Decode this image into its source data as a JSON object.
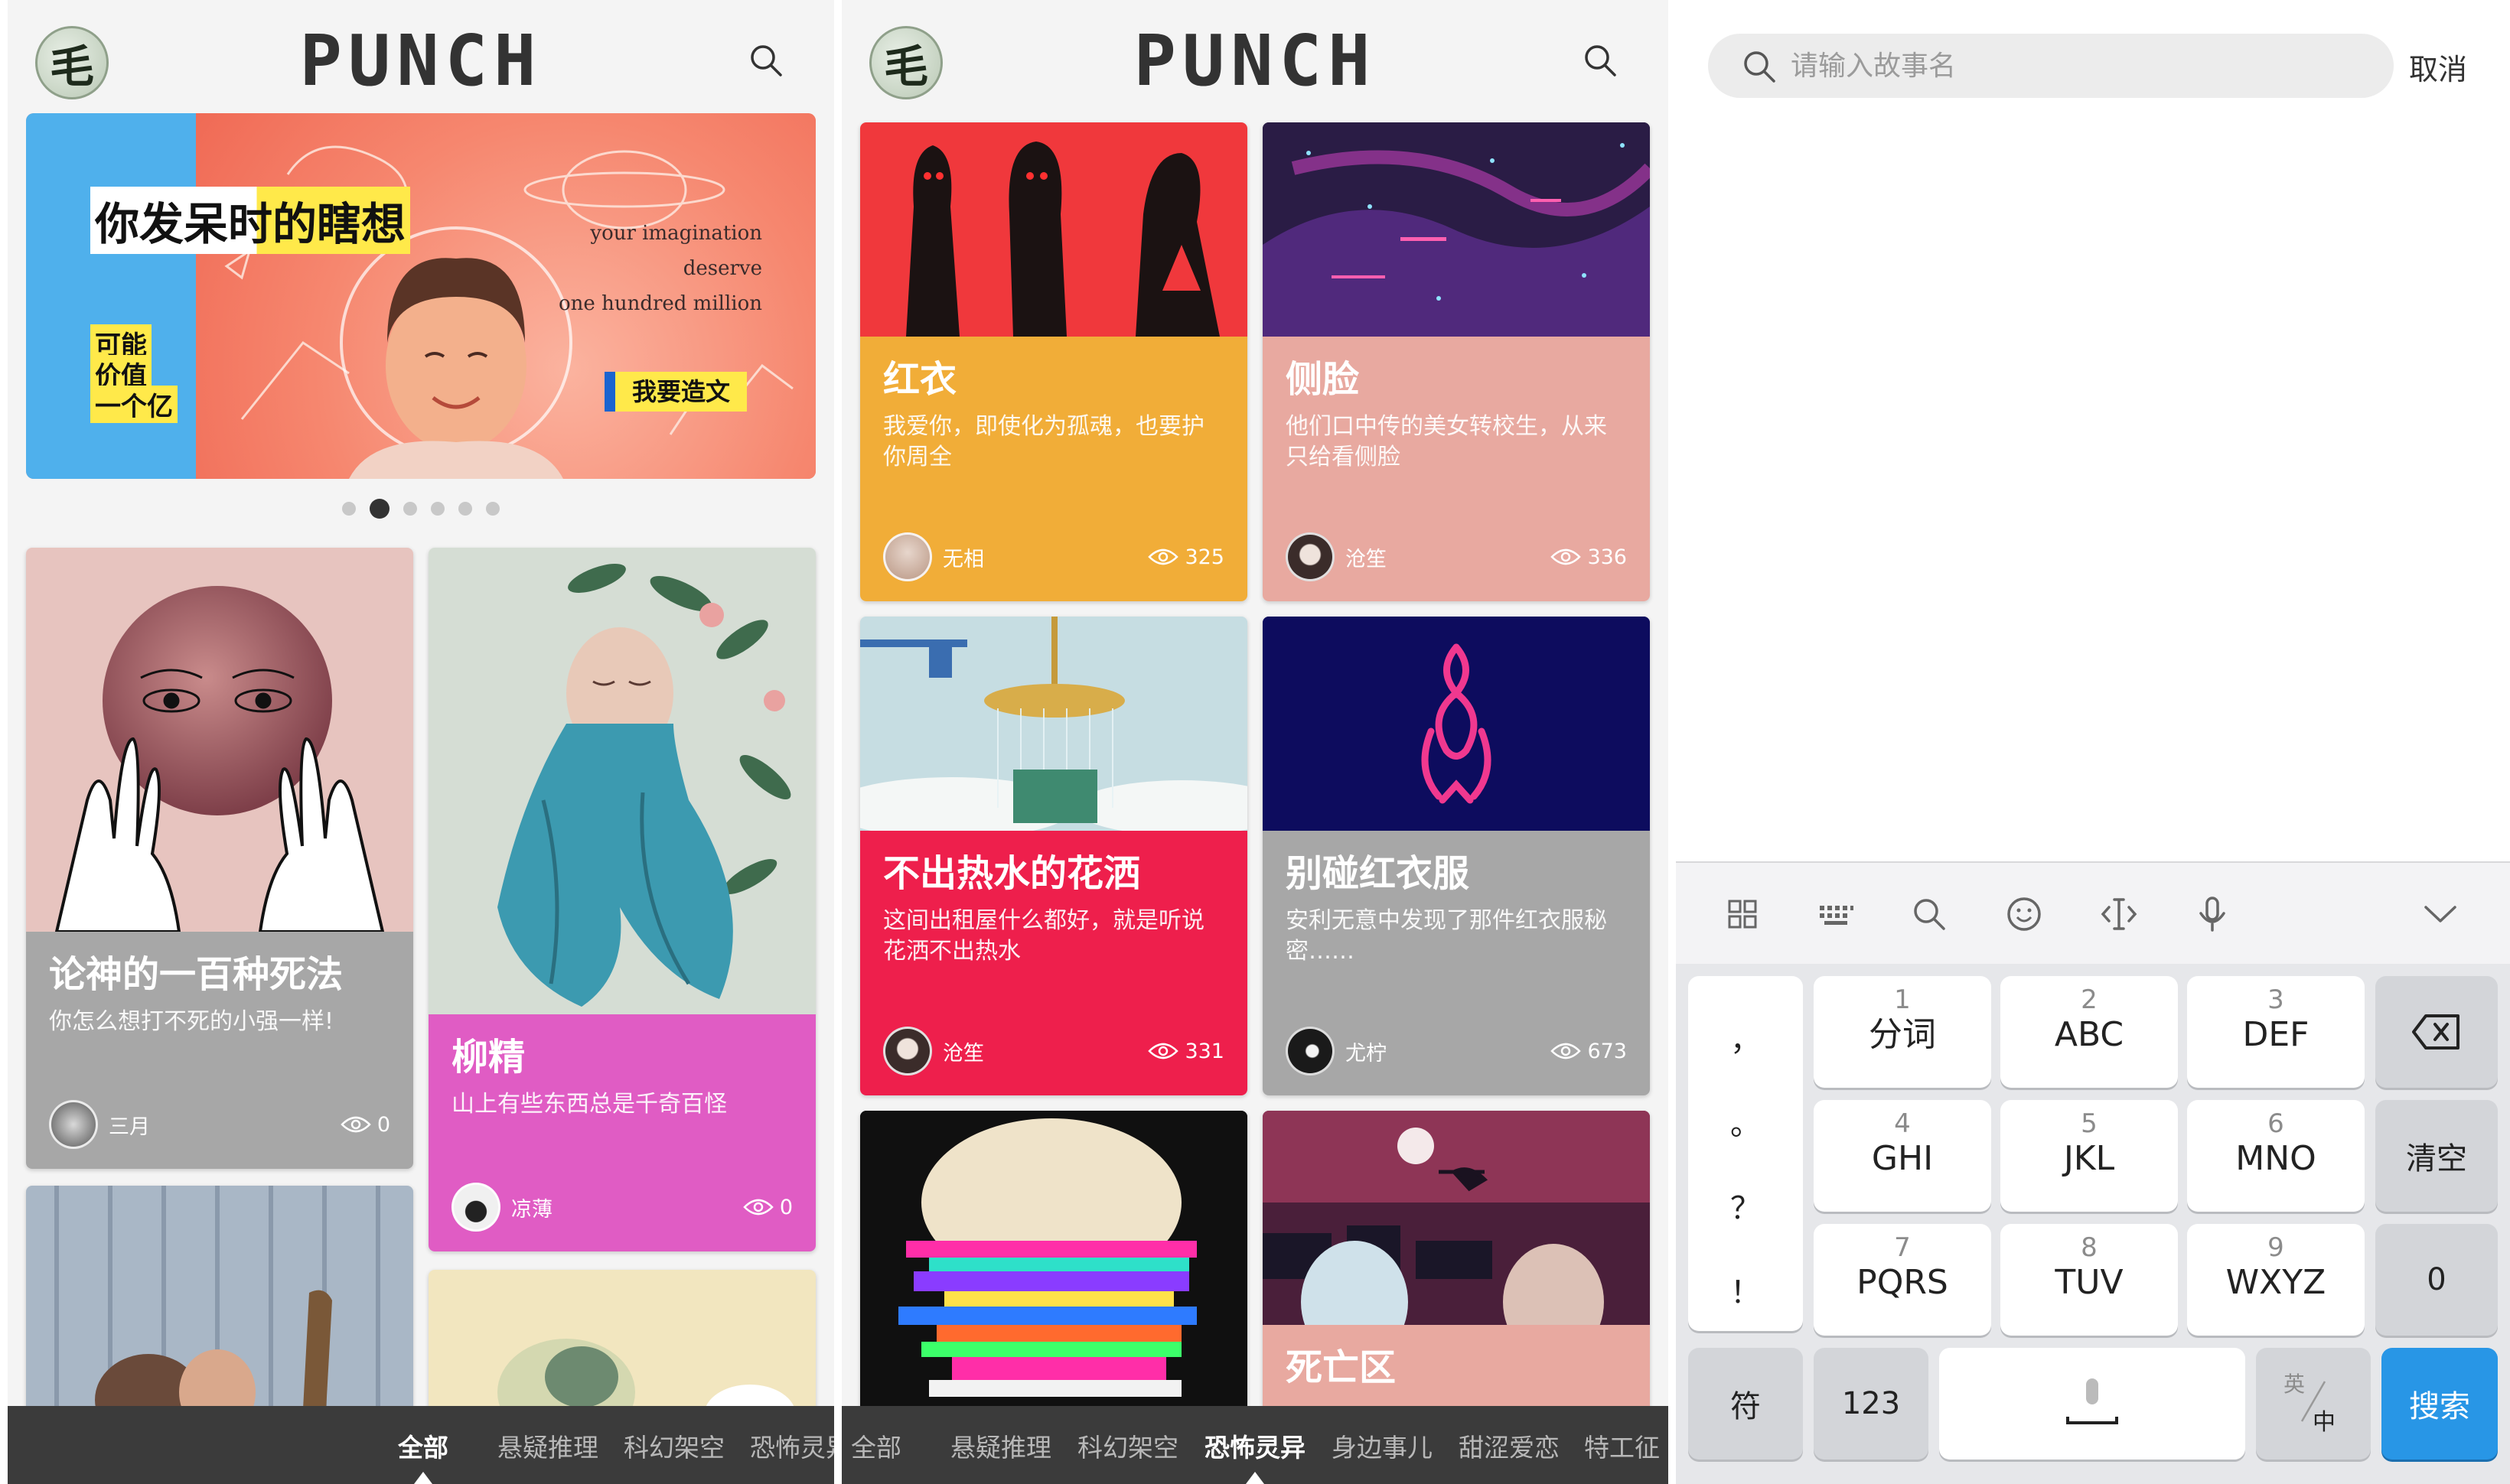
{
  "colors": {
    "accent_blue": "#2896e6",
    "category_bar": "#3b3b3b",
    "banner_blue": "#4fb0ec",
    "banner_coral": "#f5876f",
    "banner_yellow": "#ffe94a"
  },
  "app": {
    "logo_char": "毛",
    "brand": "PUNCH"
  },
  "banner": {
    "headline": "你发呆时的瞎想",
    "side_line1": "可能",
    "side_line2": "价值",
    "side_line3": "一个亿",
    "english_line1": "your imagination",
    "english_line2": "deserve",
    "english_line3": "one hundred million",
    "cta": "我要造文",
    "pager_count": 6,
    "pager_active": 2
  },
  "screen1": {
    "cards": [
      {
        "title": "论神的一百种死法",
        "desc": "你怎么想打不死的小强一样!",
        "author": "三月",
        "views": "0",
        "color": "#a7a7a7"
      },
      {
        "title": "柳精",
        "desc": "山上有些东西总是千奇百怪",
        "author": "凉薄",
        "views": "0",
        "color": "#e05cc4"
      }
    ],
    "categories": [
      "全部",
      "悬疑推理",
      "科幻架空",
      "恐怖灵异"
    ],
    "active_category": "全部"
  },
  "screen2": {
    "cards": [
      {
        "title": "红衣",
        "desc": "我爱你，即使化为孤魂，也要护你周全",
        "author": "无相",
        "views": "325",
        "color": "#f1ad38"
      },
      {
        "title": "侧脸",
        "desc": "他们口中传的美女转校生，从来只给看侧脸",
        "author": "沧笙",
        "views": "336",
        "color": "#e8a9a0"
      },
      {
        "title": "不出热水的花洒",
        "desc": "这间出租屋什么都好，就是听说花洒不出热水",
        "author": "沧笙",
        "views": "331",
        "color": "#ee1f4c"
      },
      {
        "title": "别碰红衣服",
        "desc": "安利无意中发现了那件红衣服秘密……",
        "author": "尤柠",
        "views": "673",
        "color": "#a7a7a7"
      },
      {
        "title": "死亡区",
        "color": "#e8a9a0"
      }
    ],
    "categories": [
      "全部",
      "悬疑推理",
      "科幻架空",
      "恐怖灵异",
      "身边事儿",
      "甜涩爱恋",
      "特工征"
    ],
    "active_category": "恐怖灵异"
  },
  "search": {
    "placeholder": "请输入故事名",
    "cancel": "取消"
  },
  "keyboard": {
    "tools": [
      "grid-icon",
      "keyboard-icon",
      "search-icon",
      "emoji-icon",
      "cursor-icon",
      "mic-icon",
      "collapse-icon"
    ],
    "punct": [
      "，",
      "。",
      "？",
      "！"
    ],
    "keys": [
      {
        "num": "1",
        "letters": "分词"
      },
      {
        "num": "2",
        "letters": "ABC"
      },
      {
        "num": "3",
        "letters": "DEF"
      },
      {
        "num": "4",
        "letters": "GHI"
      },
      {
        "num": "5",
        "letters": "JKL"
      },
      {
        "num": "6",
        "letters": "MNO"
      },
      {
        "num": "7",
        "letters": "PQRS"
      },
      {
        "num": "8",
        "letters": "TUV"
      },
      {
        "num": "9",
        "letters": "WXYZ"
      }
    ],
    "clear": "清空",
    "zero": "0",
    "symbols": "符",
    "numbers": "123",
    "lang_top": "英",
    "lang_bottom": "中",
    "search_key": "搜索"
  }
}
